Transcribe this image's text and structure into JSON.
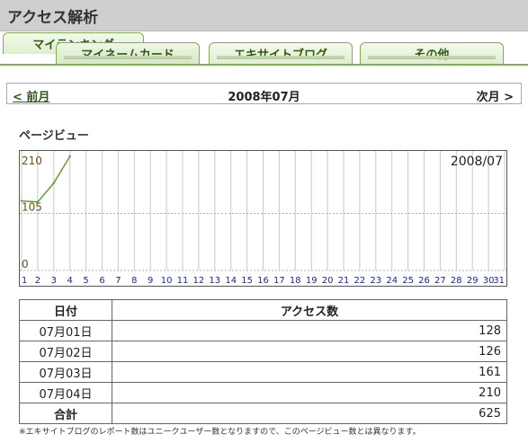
{
  "page_title": "アクセス解析",
  "tabs": [
    {
      "label": "マイランキング"
    },
    {
      "label": "マイネームカード"
    },
    {
      "label": "エキサイトブログ"
    },
    {
      "label": "その他"
    }
  ],
  "month_nav": {
    "prev": "< 前月",
    "current": "2008年07月",
    "next": "次月 >"
  },
  "section_title": "ページビュー",
  "chart_data": {
    "type": "line",
    "title": "2008/07",
    "ylim": [
      0,
      210
    ],
    "y_ticks": [
      "0",
      "105",
      "210"
    ],
    "x": [
      "1",
      "2",
      "3",
      "4",
      "5",
      "6",
      "7",
      "8",
      "9",
      "10",
      "11",
      "12",
      "13",
      "14",
      "15",
      "16",
      "17",
      "18",
      "19",
      "20",
      "21",
      "22",
      "23",
      "24",
      "25",
      "26",
      "27",
      "28",
      "29",
      "30",
      "31"
    ],
    "series": [
      {
        "values": [
          128,
          126,
          161,
          210
        ],
        "color": "#5e9e3a"
      }
    ],
    "grid": true
  },
  "table": {
    "headers": [
      "日付",
      "アクセス数"
    ],
    "rows": [
      {
        "date": "07月01日",
        "count": "128"
      },
      {
        "date": "07月02日",
        "count": "126"
      },
      {
        "date": "07月03日",
        "count": "161"
      },
      {
        "date": "07月04日",
        "count": "210"
      }
    ],
    "total_label": "合計",
    "total_value": "625"
  },
  "note": "※エキサイトブログのレポート数はユニークユーザー数となりますので、このページビュー数とは異なります。"
}
